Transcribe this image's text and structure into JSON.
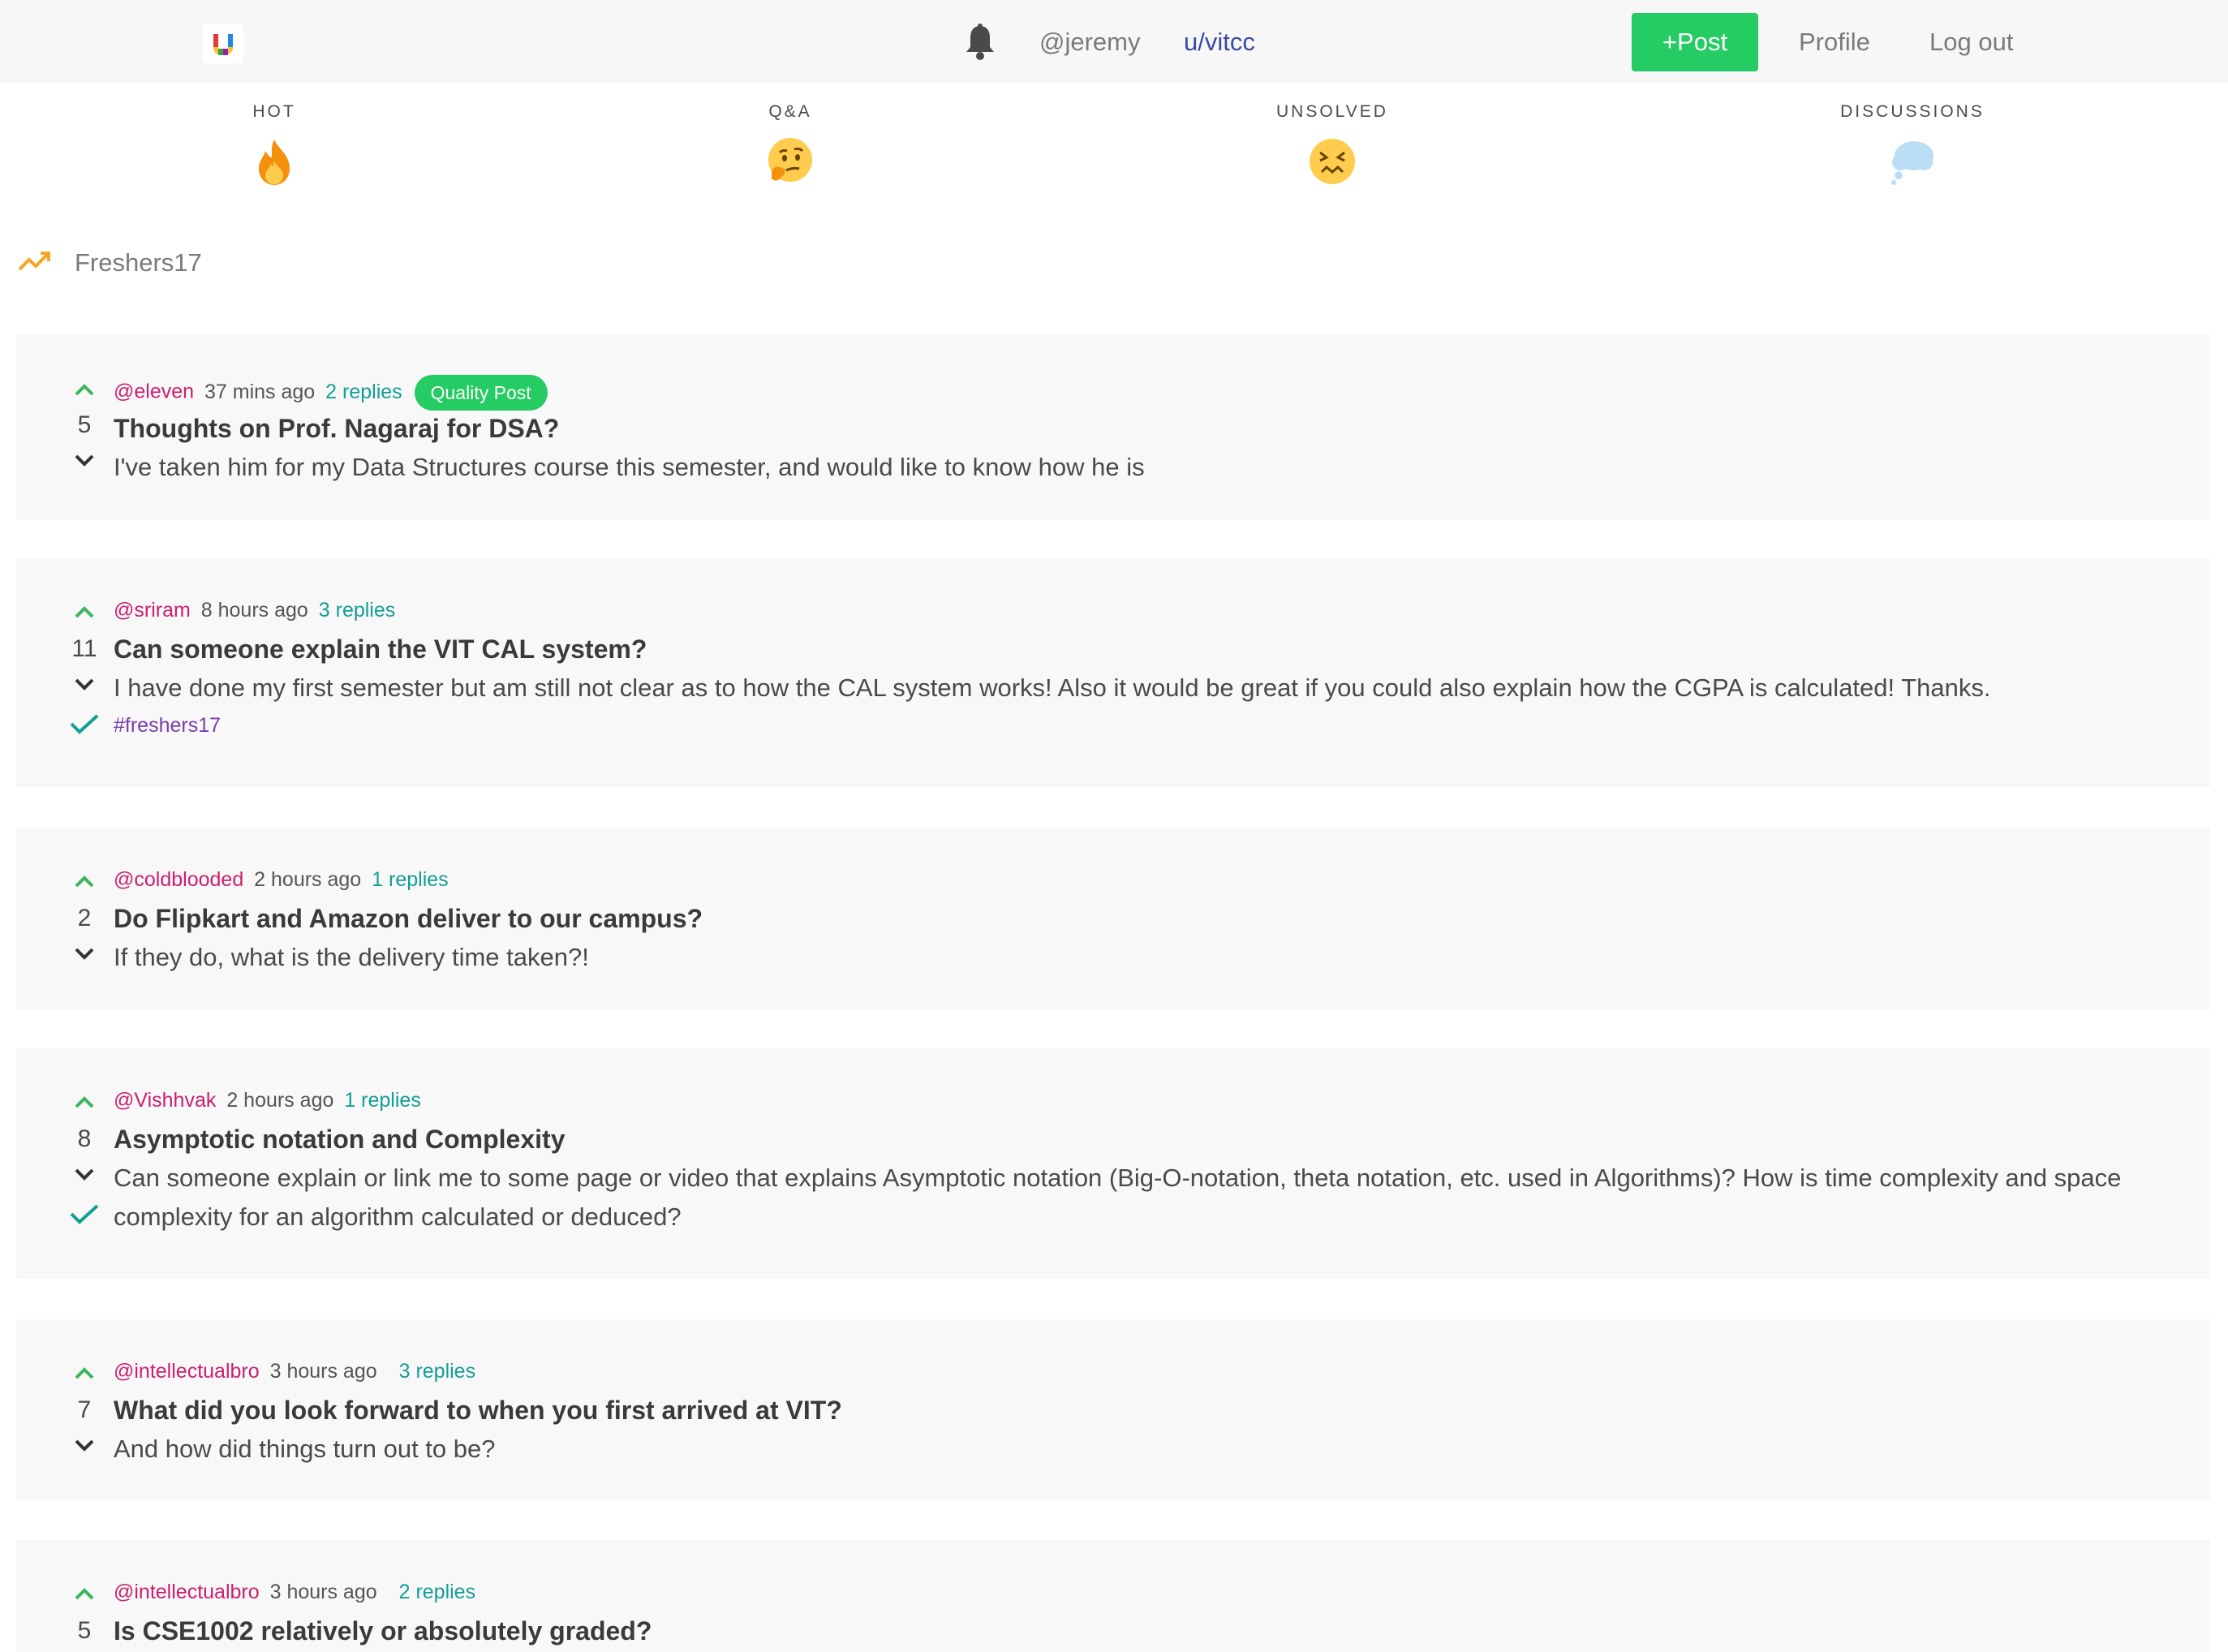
{
  "header": {
    "logo_letter": "u",
    "username": "@jeremy",
    "subreddit": "u/vitcc",
    "post_button": "+Post",
    "profile_link": "Profile",
    "logout_link": "Log out",
    "accent_color": "#24cc63"
  },
  "categories": [
    {
      "label": "HOT",
      "icon": "fire-emoji"
    },
    {
      "label": "Q&A",
      "icon": "thinking-face-emoji"
    },
    {
      "label": "UNSOLVED",
      "icon": "confounded-face-emoji"
    },
    {
      "label": "DISCUSSIONS",
      "icon": "thought-balloon-emoji"
    }
  ],
  "trending": {
    "label": "Freshers17",
    "icon": "trending-up-icon"
  },
  "posts": [
    {
      "author": "@eleven",
      "time": "37 mins ago",
      "replies": "2 replies",
      "badge": "Quality Post",
      "score": "5",
      "title": "Thoughts on Prof. Nagaraj for DSA?",
      "body": "I've taken him for my Data Structures course this semester, and would like to know how he is",
      "solved": false
    },
    {
      "author": "@sriram",
      "time": "8 hours ago",
      "replies": "3 replies",
      "score": "11",
      "title": "Can someone explain the VIT CAL system?",
      "body": "I have done my first semester but am still not clear as to how the CAL system works! Also it would be great if you could also explain how the CGPA is calculated! Thanks.",
      "tag": "#freshers17",
      "solved": true
    },
    {
      "author": "@coldblooded",
      "time": "2 hours ago",
      "replies": "1 replies",
      "score": "2",
      "title": "Do Flipkart and Amazon deliver to our campus?",
      "body": "If they do, what is the delivery time taken?!",
      "solved": false
    },
    {
      "author": "@Vishhvak",
      "time": "2 hours ago",
      "replies": "1 replies",
      "score": "8",
      "title": "Asymptotic notation and Complexity",
      "body": "Can someone explain or link me to some page or video that explains Asymptotic notation (Big-O-notation, theta notation, etc. used in Algorithms)? How is time complexity and space complexity for an algorithm calculated or deduced?",
      "solved": true
    },
    {
      "author": "@intellectualbro",
      "time": "3 hours ago",
      "replies": "3 replies",
      "score": "7",
      "title": "What did you look forward to when you first arrived at VIT?",
      "body": "And how did things turn out to be?",
      "solved": false
    },
    {
      "author": "@intellectualbro",
      "time": "3 hours ago",
      "replies": "2 replies",
      "score": "5",
      "title": "Is CSE1002 relatively or absolutely graded?",
      "solved": false
    }
  ]
}
